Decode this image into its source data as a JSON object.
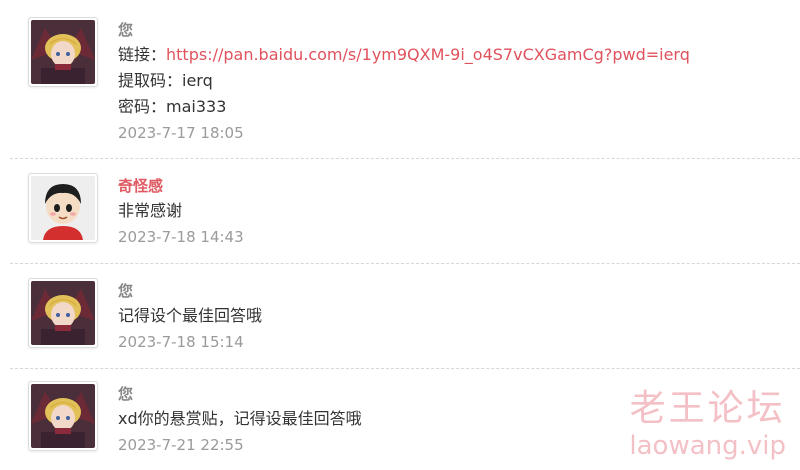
{
  "replies": [
    {
      "author": "您",
      "lines": {
        "link_label": "链接：",
        "link_url": "https://pan.baidu.com/s/1ym9QXM-9i_o4S7vCXGamCg?pwd=ierq",
        "code": "提取码：ierq",
        "password": "密码：mai333"
      },
      "time": "2023-7-17 18:05"
    },
    {
      "author": "奇怪感",
      "message": "非常感谢",
      "time": "2023-7-18 14:43"
    },
    {
      "author": "您",
      "message": "记得设个最佳回答哦",
      "time": "2023-7-18 15:14"
    },
    {
      "author": "您",
      "message": "xd你的悬赏贴，记得设最佳回答哦",
      "time": "2023-7-21 22:55"
    }
  ],
  "watermark": {
    "name": "老王论坛",
    "domain": "laowang.vip"
  },
  "colors": {
    "link": "#e0525c",
    "other_author": "#e05a63",
    "self_author": "#888888",
    "time": "#9a9a9a",
    "watermark": "#f2b6bc"
  },
  "icons": {
    "avatar_self": "anime-character-avatar",
    "avatar_other": "cartoon-boy-avatar"
  }
}
